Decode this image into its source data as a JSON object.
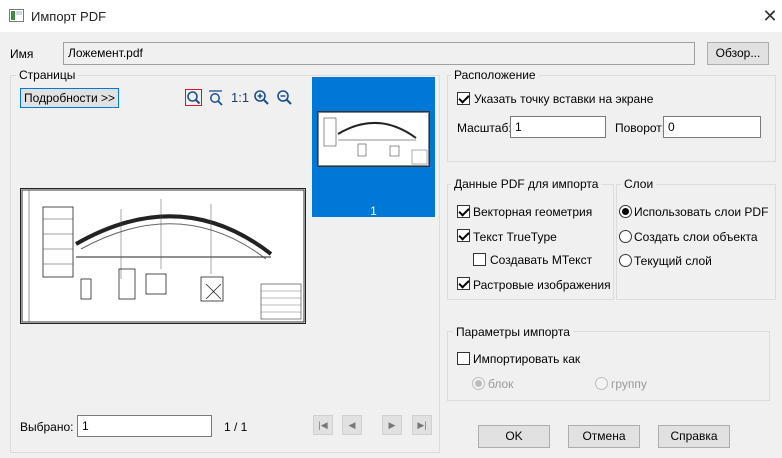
{
  "window": {
    "title": "Импорт PDF",
    "close_glyph": "✕"
  },
  "file": {
    "label": "Имя",
    "value": "Ложемент.pdf",
    "browse": "Обзор..."
  },
  "pages": {
    "legend": "Страницы",
    "details_button": "Подробности >>",
    "zoom_icons": [
      "zoom-region-icon",
      "zoom-extents-icon",
      "zoom-1to1-icon",
      "zoom-in-icon",
      "zoom-out-icon"
    ],
    "zoom_1to1_text": "1:1",
    "thumbnail_number": "1",
    "selected_label": "Выбрано:",
    "selected_value": "1",
    "page_count": "1 / 1"
  },
  "placement": {
    "legend": "Расположение",
    "specify_on_screen": "Указать точку вставки на экране",
    "scale_label": "Масштаб:",
    "scale_value": "1",
    "rotation_label": "Поворот:",
    "rotation_value": "0"
  },
  "pdf_data": {
    "legend": "Данные PDF для импорта",
    "vector": "Векторная геометрия",
    "truetype": "Текст TrueType",
    "mtext": "Создавать МТекст",
    "raster": "Растровые изображения"
  },
  "layers": {
    "legend": "Слои",
    "use_pdf": "Использовать слои PDF",
    "create_object": "Создать слои объекта",
    "current": "Текущий слой"
  },
  "import_params": {
    "legend": "Параметры импорта",
    "import_as": "Импортировать как",
    "block": "блок",
    "group": "группу"
  },
  "buttons": {
    "ok": "OK",
    "cancel": "Отмена",
    "help": "Справка"
  },
  "colors": {
    "accent": "#0078d7",
    "window_bg": "#f0f0f0",
    "zoom_region_border": "#e81123"
  }
}
